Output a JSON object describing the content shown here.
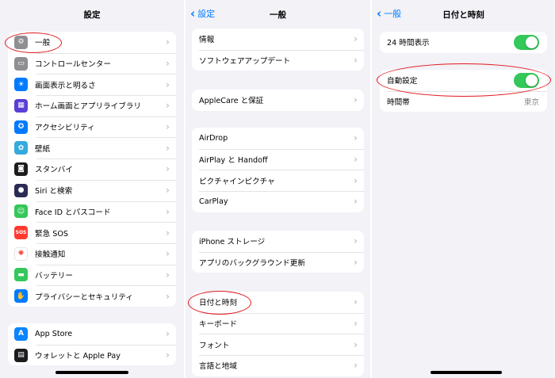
{
  "panel1": {
    "title": "設定",
    "group1": [
      {
        "label": "一般",
        "icon": "gear-icon",
        "color": "#8e8e93",
        "glyph": "⚙"
      },
      {
        "label": "コントロールセンター",
        "icon": "toggles-icon",
        "color": "#8e8e93",
        "glyph": "▭"
      },
      {
        "label": "画面表示と明るさ",
        "icon": "sun-icon",
        "color": "#007aff",
        "glyph": "☀"
      },
      {
        "label": "ホーム画面とアプリライブラリ",
        "icon": "grid-icon",
        "color": "#5b3fd6",
        "glyph": "▦"
      },
      {
        "label": "アクセシビリティ",
        "icon": "accessibility-icon",
        "color": "#007aff",
        "glyph": "✪"
      },
      {
        "label": "壁紙",
        "icon": "flower-icon",
        "color": "#35aadc",
        "glyph": "✿"
      },
      {
        "label": "スタンバイ",
        "icon": "standby-icon",
        "color": "#1c1c1e",
        "glyph": "◙"
      },
      {
        "label": "Siri と検索",
        "icon": "siri-icon",
        "color": "#2b2b55",
        "glyph": "●"
      },
      {
        "label": "Face ID とパスコード",
        "icon": "face-id-icon",
        "color": "#34c759",
        "glyph": "☺"
      },
      {
        "label": "緊急 SOS",
        "icon": "sos-icon",
        "color": "#ff3b30",
        "glyph": "SOS"
      },
      {
        "label": "接触通知",
        "icon": "exposure-icon",
        "color": "#ffffff",
        "glyph": "✺"
      },
      {
        "label": "バッテリー",
        "icon": "battery-icon",
        "color": "#34c759",
        "glyph": "▬"
      },
      {
        "label": "プライバシーとセキュリティ",
        "icon": "hand-icon",
        "color": "#007aff",
        "glyph": "✋"
      }
    ],
    "group2": [
      {
        "label": "App Store",
        "icon": "app-store-icon",
        "color": "#0a84ff",
        "glyph": "A"
      },
      {
        "label": "ウォレットと Apple Pay",
        "icon": "wallet-icon",
        "color": "#1c1c1e",
        "glyph": "▤"
      }
    ]
  },
  "panel2": {
    "title": "一般",
    "back": "設定",
    "groups": [
      [
        "情報",
        "ソフトウェアアップデート"
      ],
      [
        "AppleCare と保証"
      ],
      [
        "AirDrop",
        "AirPlay と Handoff",
        "ピクチャインピクチャ",
        "CarPlay"
      ],
      [
        "iPhone ストレージ",
        "アプリのバックグラウンド更新"
      ],
      [
        "日付と時刻",
        "キーボード",
        "フォント",
        "言語と地域"
      ]
    ]
  },
  "panel3": {
    "title": "日付と時刻",
    "back": "一般",
    "twentyfour": {
      "label": "24 時間表示",
      "on": true
    },
    "auto": {
      "label": "自動設定",
      "on": true
    },
    "timezone": {
      "label": "時間帯",
      "value": "東京"
    }
  },
  "chevron": "›",
  "colors": {
    "accent": "#007aff",
    "toggle_on": "#34c759",
    "highlight": "#e0191e"
  }
}
